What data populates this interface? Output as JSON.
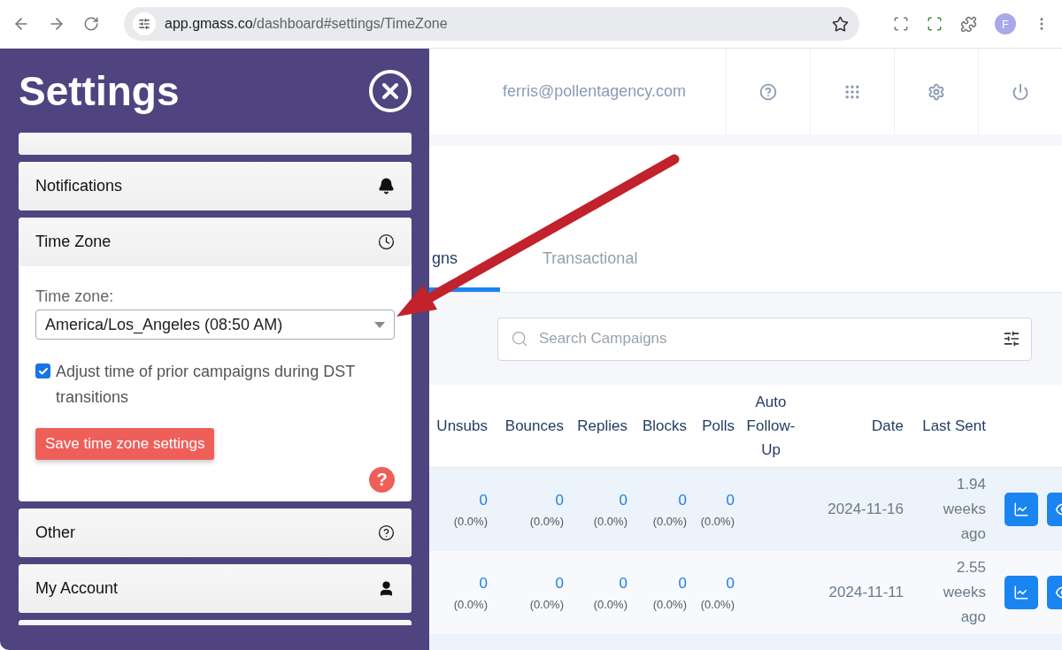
{
  "browser": {
    "url_host": "app.gmass.co",
    "url_path": "/dashboard#settings/TimeZone",
    "profile_initial": "F"
  },
  "header": {
    "email": "ferris@pollentagency.com"
  },
  "tabs": [
    {
      "label": "gns",
      "selected": true
    },
    {
      "label": "Transactional",
      "selected": false
    }
  ],
  "search": {
    "placeholder": "Search Campaigns"
  },
  "table": {
    "columns": [
      "Unsubs",
      "Bounces",
      "Replies",
      "Blocks",
      "Polls",
      "Auto Follow-Up",
      "Date",
      "Last Sent"
    ],
    "rows": [
      {
        "counts": [
          {
            "value": "0",
            "percent": "(0.0%)"
          },
          {
            "value": "0",
            "percent": "(0.0%)"
          },
          {
            "value": "0",
            "percent": "(0.0%)"
          },
          {
            "value": "0",
            "percent": "(0.0%)"
          },
          {
            "value": "0",
            "percent": "(0.0%)"
          }
        ],
        "date": "2024-11-16",
        "last_sent": "1.94 weeks ago"
      },
      {
        "counts": [
          {
            "value": "0",
            "percent": "(0.0%)"
          },
          {
            "value": "0",
            "percent": "(0.0%)"
          },
          {
            "value": "0",
            "percent": "(0.0%)"
          },
          {
            "value": "0",
            "percent": "(0.0%)"
          },
          {
            "value": "0",
            "percent": "(0.0%)"
          }
        ],
        "date": "2024-11-11",
        "last_sent": "2.55 weeks ago"
      }
    ]
  },
  "settings": {
    "title": "Settings",
    "sections": [
      {
        "expanded": false
      },
      {
        "title": "Notifications",
        "expanded": false
      },
      {
        "title": "Time Zone",
        "expanded": true
      },
      {
        "title": "Other",
        "expanded": false
      },
      {
        "title": "My Account",
        "expanded": false
      },
      {
        "expanded": false
      }
    ],
    "time_zone": {
      "label": "Time zone:",
      "value": "America/Los_Angeles (08:50 AM)",
      "dst_checkbox": {
        "label": "Adjust time of prior campaigns during DST transitions",
        "checked": true
      },
      "save_button": "Save time zone settings",
      "help_button": "?"
    }
  }
}
